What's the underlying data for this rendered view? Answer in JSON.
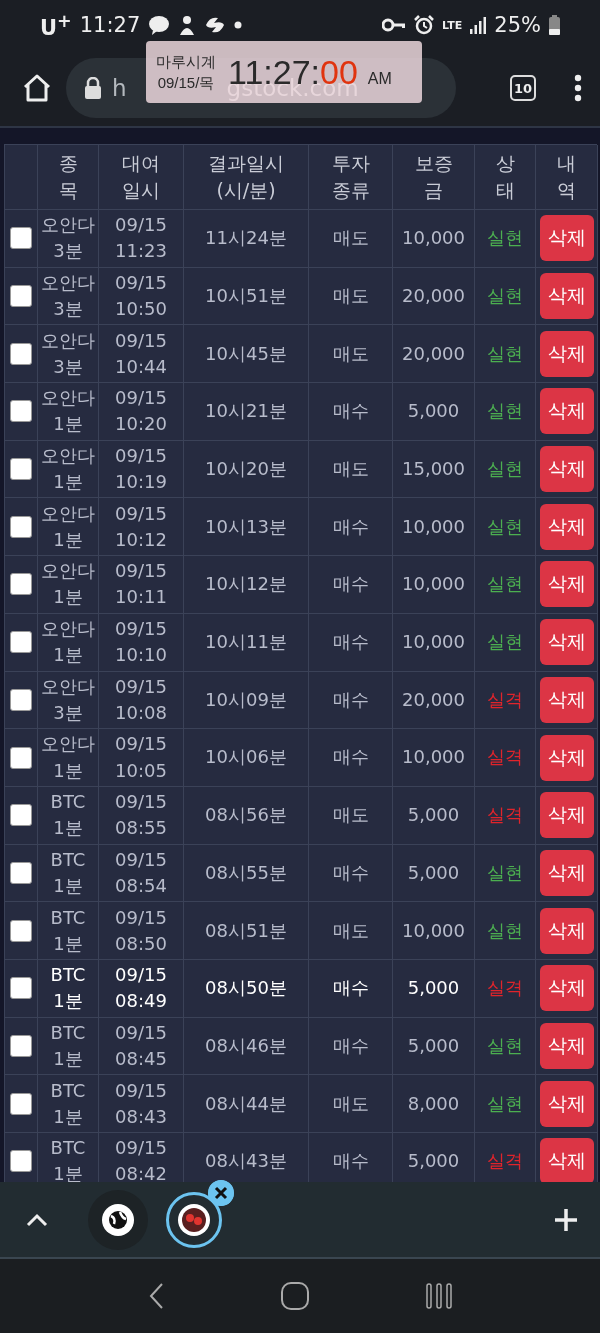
{
  "status_bar": {
    "carrier": "U$^{+}$",
    "time": "11:27",
    "network": "LTE",
    "battery": "25%"
  },
  "clock_overlay": {
    "title": "마루시계",
    "date": "09/15/목",
    "time": "11:27:",
    "seconds": "00",
    "ampm": "AM"
  },
  "browser": {
    "url_start": "h",
    "url_end": "gstock.com",
    "tab_count": "10"
  },
  "table": {
    "columns": [
      {
        "label": "종\n목"
      },
      {
        "label": "대여\n일시"
      },
      {
        "label": "결과일시\n(시/분)"
      },
      {
        "label": "투자\n종류"
      },
      {
        "label": "보증\n금"
      },
      {
        "label": "상\n태"
      },
      {
        "label": "내\n역"
      }
    ],
    "rows": [
      {
        "checked": false,
        "highlighted": false,
        "symbol": "오안다",
        "period": "3분",
        "date": "09/15",
        "time": "11:23",
        "result_time": "11시24분",
        "type": "매도",
        "amount": "10,000",
        "status": "실현",
        "color": "#4caf50",
        "action": "삭제"
      },
      {
        "checked": false,
        "highlighted": false,
        "symbol": "오안다",
        "period": "3분",
        "date": "09/15",
        "time": "10:50",
        "result_time": "10시51분",
        "type": "매도",
        "amount": "20,000",
        "status": "실현",
        "color": "#4caf50",
        "action": "삭제"
      },
      {
        "checked": false,
        "highlighted": false,
        "symbol": "오안다",
        "period": "3분",
        "date": "09/15",
        "time": "10:44",
        "result_time": "10시45분",
        "type": "매도",
        "amount": "20,000",
        "status": "실현",
        "color": "#4caf50",
        "action": "삭제"
      },
      {
        "checked": false,
        "highlighted": false,
        "symbol": "오안다",
        "period": "1분",
        "date": "09/15",
        "time": "10:20",
        "result_time": "10시21분",
        "type": "매수",
        "amount": "5,000",
        "status": "실현",
        "color": "#4caf50",
        "action": "삭제"
      },
      {
        "checked": false,
        "highlighted": false,
        "symbol": "오안다",
        "period": "1분",
        "date": "09/15",
        "time": "10:19",
        "result_time": "10시20분",
        "type": "매도",
        "amount": "15,000",
        "status": "실현",
        "color": "#4caf50",
        "action": "삭제"
      },
      {
        "checked": false,
        "highlighted": false,
        "symbol": "오안다",
        "period": "1분",
        "date": "09/15",
        "time": "10:12",
        "result_time": "10시13분",
        "type": "매수",
        "amount": "10,000",
        "status": "실현",
        "color": "#4caf50",
        "action": "삭제"
      },
      {
        "checked": false,
        "highlighted": false,
        "symbol": "오안다",
        "period": "1분",
        "date": "09/15",
        "time": "10:11",
        "result_time": "10시12분",
        "type": "매수",
        "amount": "10,000",
        "status": "실현",
        "color": "#4caf50",
        "action": "삭제"
      },
      {
        "checked": false,
        "highlighted": false,
        "symbol": "오안다",
        "period": "1분",
        "date": "09/15",
        "time": "10:10",
        "result_time": "10시11분",
        "type": "매수",
        "amount": "10,000",
        "status": "실현",
        "color": "#4caf50",
        "action": "삭제"
      },
      {
        "checked": false,
        "highlighted": false,
        "symbol": "오안다",
        "period": "3분",
        "date": "09/15",
        "time": "10:08",
        "result_time": "10시09분",
        "type": "매수",
        "amount": "20,000",
        "status": "실격",
        "color": "#e0242b",
        "action": "삭제"
      },
      {
        "checked": false,
        "highlighted": false,
        "symbol": "오안다",
        "period": "1분",
        "date": "09/15",
        "time": "10:05",
        "result_time": "10시06분",
        "type": "매수",
        "amount": "10,000",
        "status": "실격",
        "color": "#e0242b",
        "action": "삭제"
      },
      {
        "checked": false,
        "highlighted": false,
        "symbol": "BTC",
        "period": "1분",
        "date": "09/15",
        "time": "08:55",
        "result_time": "08시56분",
        "type": "매도",
        "amount": "5,000",
        "status": "실격",
        "color": "#e0242b",
        "action": "삭제"
      },
      {
        "checked": false,
        "highlighted": false,
        "symbol": "BTC",
        "period": "1분",
        "date": "09/15",
        "time": "08:54",
        "result_time": "08시55분",
        "type": "매수",
        "amount": "5,000",
        "status": "실현",
        "color": "#4caf50",
        "action": "삭제"
      },
      {
        "checked": false,
        "highlighted": false,
        "symbol": "BTC",
        "period": "1분",
        "date": "09/15",
        "time": "08:50",
        "result_time": "08시51분",
        "type": "매도",
        "amount": "10,000",
        "status": "실현",
        "color": "#4caf50",
        "action": "삭제"
      },
      {
        "checked": false,
        "highlighted": true,
        "symbol": "BTC",
        "period": "1분",
        "date": "09/15",
        "time": "08:49",
        "result_time": "08시50분",
        "type": "매수",
        "amount": "5,000",
        "status": "실격",
        "color": "#e0242b",
        "action": "삭제"
      },
      {
        "checked": false,
        "highlighted": false,
        "symbol": "BTC",
        "period": "1분",
        "date": "09/15",
        "time": "08:45",
        "result_time": "08시46분",
        "type": "매수",
        "amount": "5,000",
        "status": "실현",
        "color": "#4caf50",
        "action": "삭제"
      },
      {
        "checked": false,
        "highlighted": false,
        "symbol": "BTC",
        "period": "1분",
        "date": "09/15",
        "time": "08:43",
        "result_time": "08시44분",
        "type": "매도",
        "amount": "8,000",
        "status": "실현",
        "color": "#4caf50",
        "action": "삭제"
      },
      {
        "checked": false,
        "highlighted": false,
        "symbol": "BTC",
        "period": "1분",
        "date": "09/15",
        "time": "08:42",
        "result_time": "08시43분",
        "type": "매수",
        "amount": "5,000",
        "status": "실격",
        "color": "#e0242b",
        "action": "삭제"
      }
    ]
  },
  "tab_strip": {
    "tabs": [
      {
        "selected": false,
        "kind": "globe"
      },
      {
        "selected": true,
        "kind": "site"
      }
    ]
  }
}
